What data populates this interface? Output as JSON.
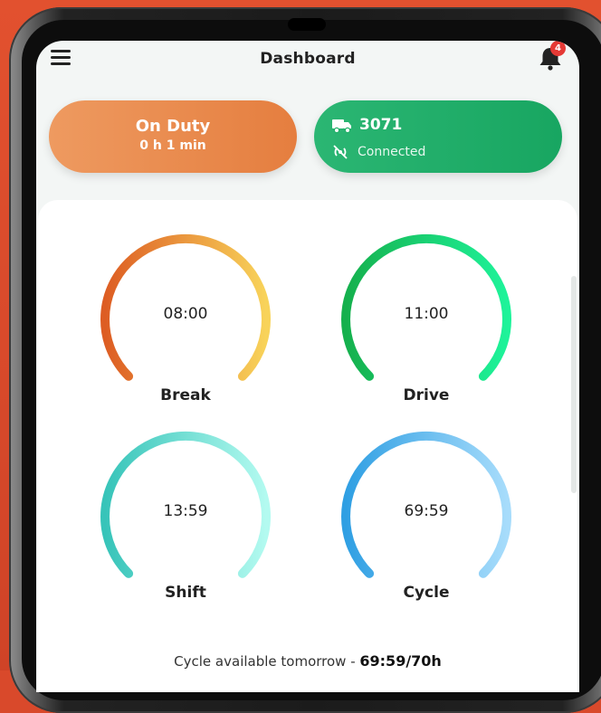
{
  "header": {
    "title": "Dashboard",
    "notification_count": "4"
  },
  "status_card": {
    "status": "On Duty",
    "duration": "0 h 1 min",
    "color": "#e8874a"
  },
  "vehicle_card": {
    "vehicle_number": "3071",
    "connection_status": "Connected",
    "color": "#21ae68"
  },
  "gauges": [
    {
      "label": "Break",
      "value": "08:00",
      "colors": [
        "#dd5d23",
        "#f8d35a"
      ]
    },
    {
      "label": "Drive",
      "value": "11:00",
      "colors": [
        "#15b04d",
        "#1ef39a"
      ]
    },
    {
      "label": "Shift",
      "value": "13:59",
      "colors": [
        "#37c4b9",
        "#b3faf0"
      ]
    },
    {
      "label": "Cycle",
      "value": "69:59",
      "colors": [
        "#2f9fe3",
        "#a7dcfb"
      ]
    }
  ],
  "footer": {
    "text": "Cycle available tomorrow - ",
    "value": "69:59/70h"
  },
  "icons": [
    "hamburger-menu-icon",
    "bell-icon",
    "truck-icon",
    "connection-icon"
  ]
}
